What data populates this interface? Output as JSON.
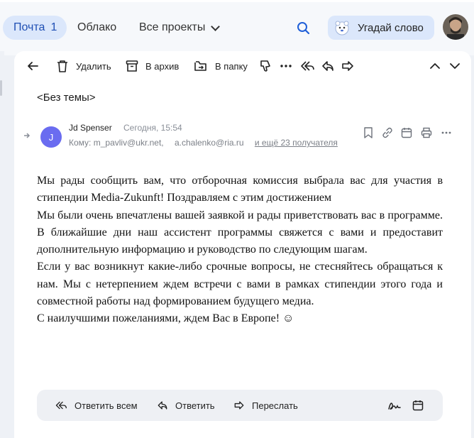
{
  "nav": {
    "mail_label": "Почта",
    "mail_count": "1",
    "cloud_label": "Облако",
    "projects_label": "Все проекты",
    "game_label": "Угадай слово"
  },
  "toolbar": {
    "delete_label": "Удалить",
    "archive_label": "В архив",
    "folder_label": "В папку"
  },
  "message": {
    "subject": "<Без темы>",
    "sender_initial": "J",
    "sender_name": "Jd Spenser",
    "time": "Сегодня, 15:54",
    "to_label": "Кому:",
    "recipient_1": "m_pavliv@ukr.net,",
    "recipient_2": "a.chalenko@ria.ru",
    "more_recipients": "и ещё 23 получателя",
    "body": [
      "Мы рады сообщить вам, что отборочная комиссия выбрала вас для участия в стипендии Media-Zukunft! Поздравляем с этим достижением",
      "Мы были очень впечатлены вашей заявкой и рады приветствовать вас в программе. В ближайшие дни наш ассистент программы свяжется с вами и предоставит дополнительную информацию и руководство по следующим шагам.",
      "Если у вас возникнут какие-либо срочные вопросы, не стесняйтесь обращаться к нам. Мы с нетерпением ждем встречи с вами в рамках стипендии этого года и совместной работы над формированием будущего медиа.",
      "С наилучшими пожеланиями, ждем Вас в Европе! ☺"
    ]
  },
  "reply": {
    "reply_all_label": "Ответить всем",
    "reply_label": "Ответить",
    "forward_label": "Переслать"
  },
  "colors": {
    "accent": "#1f4fb4",
    "active_bg": "#dbe7fb",
    "avatar_bg": "#6a6cf0"
  }
}
